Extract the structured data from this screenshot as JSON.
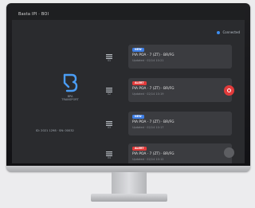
{
  "window": {
    "title": "Basta IPI · BOI"
  },
  "status": {
    "label": "Connected",
    "dot_color": "#3d8ef0"
  },
  "device": {
    "icon": "router-b-logo-icon",
    "name_lines": [
      "BPA",
      "TRANSPORT"
    ],
    "id_line": "ID: 2021 1298  ·  SN: 00032"
  },
  "lanes": [
    {
      "number": "01"
    },
    {
      "number": "02"
    },
    {
      "number": "03"
    },
    {
      "number": "04"
    }
  ],
  "cards": [
    {
      "badge": "NEW",
      "badge_color": "#3f7fe6",
      "title": "PIA POA · 7 (ZT) · BR/FG",
      "subtitle": "Updated · 02/14 10:21"
    },
    {
      "badge": "ALERT",
      "badge_color": "#e23b3b",
      "title": "PIA POA · 7 (ZT) · BR/FG",
      "subtitle": "Updated · 02/14 10:19"
    },
    {
      "badge": "NEW",
      "badge_color": "#3f7fe6",
      "title": "PIA POA · 7 (ZT) · BR/FG",
      "subtitle": "Updated · 02/14 10:17"
    },
    {
      "badge": "ALERT",
      "badge_color": "#e23b3b",
      "title": "PIA POA · 7 (ZT) · BR/FG",
      "subtitle": "Updated · 02/14 10:12"
    }
  ],
  "colors": {
    "screen_bg": "#2a2b2e",
    "card_bg": "#3b3c40",
    "accent_blue": "#3f7fe6",
    "danger_red": "#e23b3b",
    "device_icon_blue": "#4a9df5"
  }
}
